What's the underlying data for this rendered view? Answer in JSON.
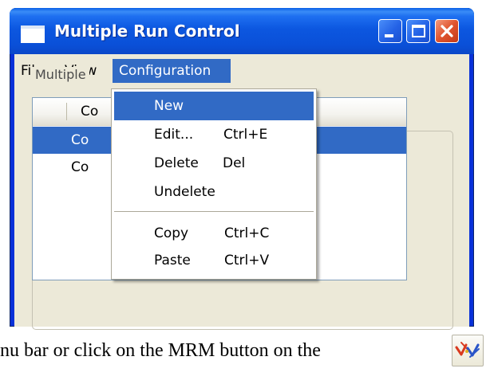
{
  "window": {
    "title": "Multiple Run Control",
    "controls": [
      "minimize",
      "maximize",
      "close"
    ]
  },
  "menubar": {
    "items": [
      {
        "label": "File"
      },
      {
        "label": "View"
      },
      {
        "label": "Configuration",
        "active": true
      }
    ]
  },
  "dropdown": {
    "items": [
      {
        "label": "New",
        "shortcut": "",
        "highlighted": true
      },
      {
        "label": "Edit...",
        "shortcut": "Ctrl+E"
      },
      {
        "label": "Delete",
        "shortcut": "Del"
      },
      {
        "label": "Undelete",
        "shortcut": ""
      },
      {
        "label": "Copy",
        "shortcut": "Ctrl+C"
      },
      {
        "label": "Paste",
        "shortcut": "Ctrl+V"
      }
    ]
  },
  "group": {
    "label": "Multiple"
  },
  "list": {
    "column_header": "Co",
    "rows": [
      {
        "text": "Co",
        "selected": true
      },
      {
        "text": "Co",
        "selected": false
      }
    ]
  },
  "document": {
    "text": "nu bar or click on the MRM button on the"
  },
  "icons": {
    "window": "window-icon",
    "mrm_button": "mrm-icon"
  },
  "colors": {
    "titlebar": "#0a50d8",
    "selection": "#316ac5",
    "close_button": "#e0542e",
    "window_face": "#ece9d8"
  }
}
